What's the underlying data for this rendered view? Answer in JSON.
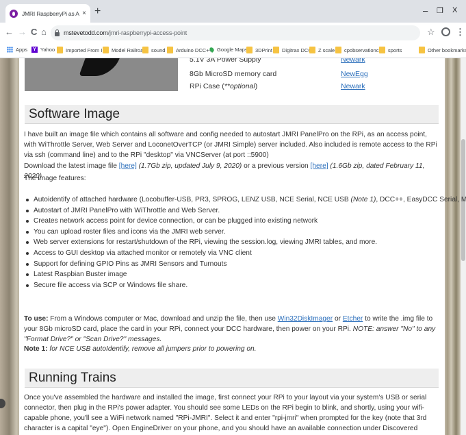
{
  "browser": {
    "tab_title": "JMRI RaspberryPi as Access Point",
    "tab_close": "×",
    "new_tab": "+",
    "minimize": "–",
    "restore": "❐",
    "close": "X",
    "back": "←",
    "forward": "→",
    "reload": "C",
    "home": "⌂",
    "url_domain": "mstevetodd.com",
    "url_path": "/jmri-raspberrypi-access-point",
    "star": "☆",
    "menu": "⋮"
  },
  "bookmarks": [
    {
      "label": "Apps",
      "icon": "apps-grid-icon"
    },
    {
      "label": "Yahoo",
      "icon": "yahoo-icon"
    },
    {
      "label": "Imported From IE",
      "icon": "folder-icon"
    },
    {
      "label": "Model Railroad",
      "icon": "folder-icon"
    },
    {
      "label": "sound",
      "icon": "folder-icon"
    },
    {
      "label": "Arduino DCC++",
      "icon": "folder-icon"
    },
    {
      "label": "Google Maps",
      "icon": "maps-pin-icon"
    },
    {
      "label": "3DPrint",
      "icon": "folder-icon"
    },
    {
      "label": "Digitrax DCC",
      "icon": "folder-icon"
    },
    {
      "label": "Z scale",
      "icon": "folder-icon"
    },
    {
      "label": "cpobservationcar",
      "icon": "folder-icon"
    },
    {
      "label": "sports",
      "icon": "folder-icon"
    },
    {
      "label": "Other bookmarks",
      "icon": "folder-icon"
    }
  ],
  "parts": [
    {
      "item": "5.1V 3A Power Supply",
      "vendor": "Newark"
    },
    {
      "item": "8Gb MicroSD memory card",
      "vendor": "NewEgg"
    },
    {
      "item_prefix": "RPi Case (",
      "item_italic": "**optional",
      "item_suffix": ")",
      "vendor": "Newark"
    }
  ],
  "software_image": {
    "heading": "Software Image",
    "intro": "I have built an image file which contains all software and config needed to autostart JMRI PanelPro on the RPi, as an access point, with WiThrottle Server, Web Server and LoconetOverTCP (or JMRI Simple) server included.  Also included is remote access to the RPi via ssh (command line) and to the RPi \"desktop\" via VNCServer (at port ::5900)",
    "download_prefix": "Download the latest image file ",
    "download_link": "[here]",
    "download_note": " (1.7Gb zip, updated July 9, 2020)",
    "download_mid": " or a previous version ",
    "previous_link": "[here]",
    "previous_note": " (1.6Gb zip, dated February 11, 2020)",
    "features_label": "The image features:",
    "features": [
      {
        "text": "Autoidentify of attached hardware (Locobuffer-USB, PR3, SPROG, LENZ USB, NCE Serial, NCE USB ",
        "note": "(Note 1)",
        "rest": ", DCC++, EasyDCC Serial, MERG USB, MRC Prodigy)"
      },
      {
        "text": "Autostart of JMRI PanelPro with WiThrottle and Web Server.",
        "note": "",
        "rest": ""
      },
      {
        "text": "Creates network access point for device connection, or can be plugged into existing network",
        "note": "",
        "rest": ""
      },
      {
        "text": "You can upload roster files and icons via the JMRI web server.",
        "note": "",
        "rest": ""
      },
      {
        "text": "Web server extensions for restart/shutdown of the RPi, viewing the session.log, viewing JMRI tables, and more.",
        "note": "",
        "rest": ""
      },
      {
        "text": "Access to GUI desktop via attached monitor or remotely via VNC client",
        "note": "",
        "rest": ""
      },
      {
        "text": "Support for defining GPIO Pins as JMRI Sensors and Turnouts",
        "note": "",
        "rest": ""
      },
      {
        "text": "Latest Raspbian Buster image",
        "note": "",
        "rest": ""
      },
      {
        "text": "Secure file access via SCP or Windows file share.",
        "note": "",
        "rest": ""
      }
    ],
    "to_use_label": "To use:",
    "to_use_1": " From a Windows computer or Mac, download and unzip the file, then use ",
    "win32_link": "Win32DiskImager",
    "to_use_or": " or ",
    "etcher_link": "Etcher",
    "to_use_2": " to write the .img file to your 8Gb microSD card, place the card in your RPi, connect your DCC hardware, then power on your RPi. ",
    "to_use_note": "NOTE: answer \"No\" to any \"Format Drive?\"  or \"Scan Drive?\" messages.",
    "note1_label": "Note 1:",
    "note1_text": " for NCE USB autoIdentify, remove all jumpers prior to powering on."
  },
  "running_trains": {
    "heading": "Running Trains",
    "text": "Once you've assembled the hardware and installed the image, first connect your RPi to your layout via your system's USB or serial connector, then plug in the RPi's power adapter.  You should see some LEDs on the RPi begin to blink, and shortly, using your wifi-capable phone, you'll see a WiFi network named \"RPi-JMRI\". Select it and enter \"rpi-jmri\" when prompted for the key (note that 3rd character is a capital \"eye\"). Open EngineDriver on your phone, and you should have an available connection under Discovered Servers named \"RPi-JMRI (connection name)\". (Similar with WiThrottle on iPhone). Select that server, then enter loco address and run."
  }
}
